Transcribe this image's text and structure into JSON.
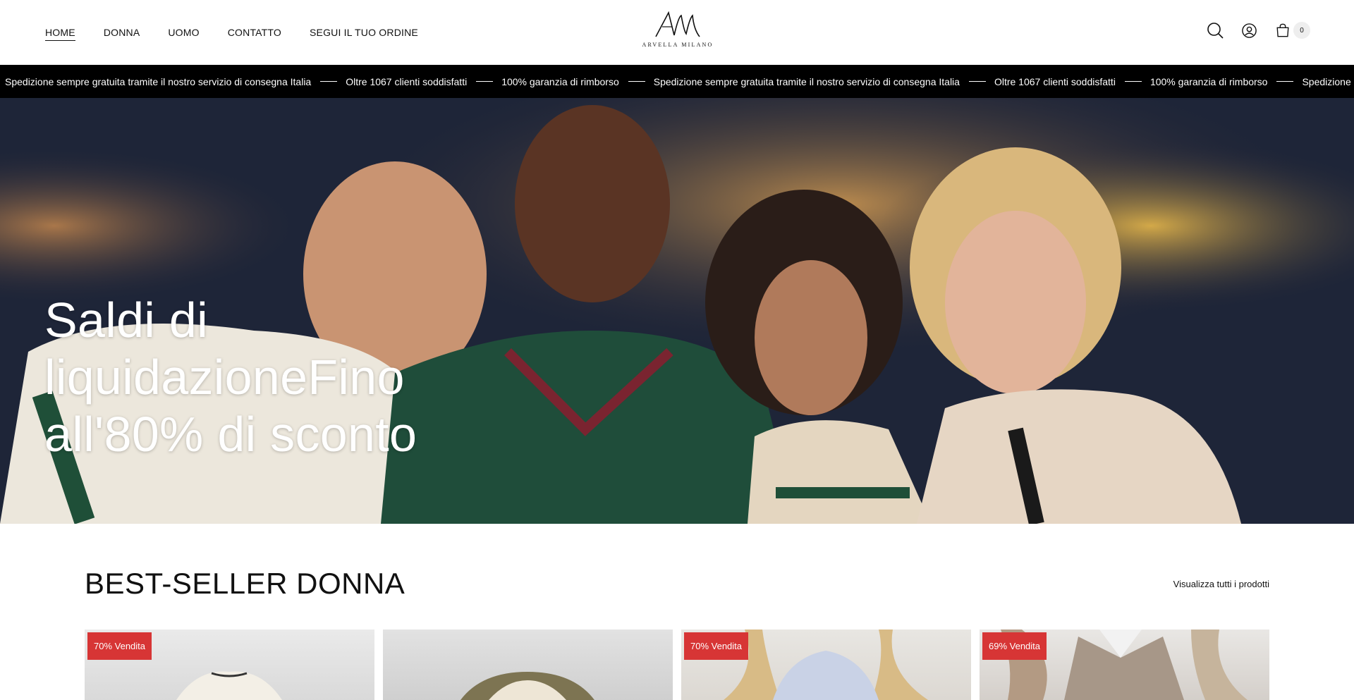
{
  "header": {
    "nav": [
      {
        "label": "HOME",
        "active": true
      },
      {
        "label": "DONNA",
        "active": false
      },
      {
        "label": "UOMO",
        "active": false
      },
      {
        "label": "CONTATTO",
        "active": false
      },
      {
        "label": "SEGUI IL TUO ORDINE",
        "active": false
      }
    ],
    "logo": {
      "mark": "AM",
      "text": "ARVELLA MILANO"
    },
    "icons": [
      "search-icon",
      "account-icon",
      "bag-icon"
    ],
    "cart_count": "0"
  },
  "marquee": {
    "items": [
      "Spedizione sempre gratuita tramite il nostro servizio di consegna Italia",
      "Oltre 1067 clienti soddisfatti",
      "100% garanzia di rimborso",
      "Spedizione sempre gratuita tramite il nostro servizio di consegna Italia",
      "Oltre 1067 clienti soddisfatti",
      "100% garanzia di rimborso",
      "Spedizione sempre gratuita tramite il nostro servizio di consegna Italia"
    ]
  },
  "hero": {
    "title": "Saldi di liquidazioneFino all'80% di sconto"
  },
  "bestseller": {
    "title": "BEST-SELLER DONNA",
    "view_all": "Visualizza tutti i prodotti",
    "products": [
      {
        "badge": "70% Vendita"
      },
      {
        "badge": ""
      },
      {
        "badge": "70% Vendita"
      },
      {
        "badge": "69% Vendita"
      }
    ]
  },
  "colors": {
    "badge": "#d73535",
    "marquee_bg": "#000000"
  }
}
